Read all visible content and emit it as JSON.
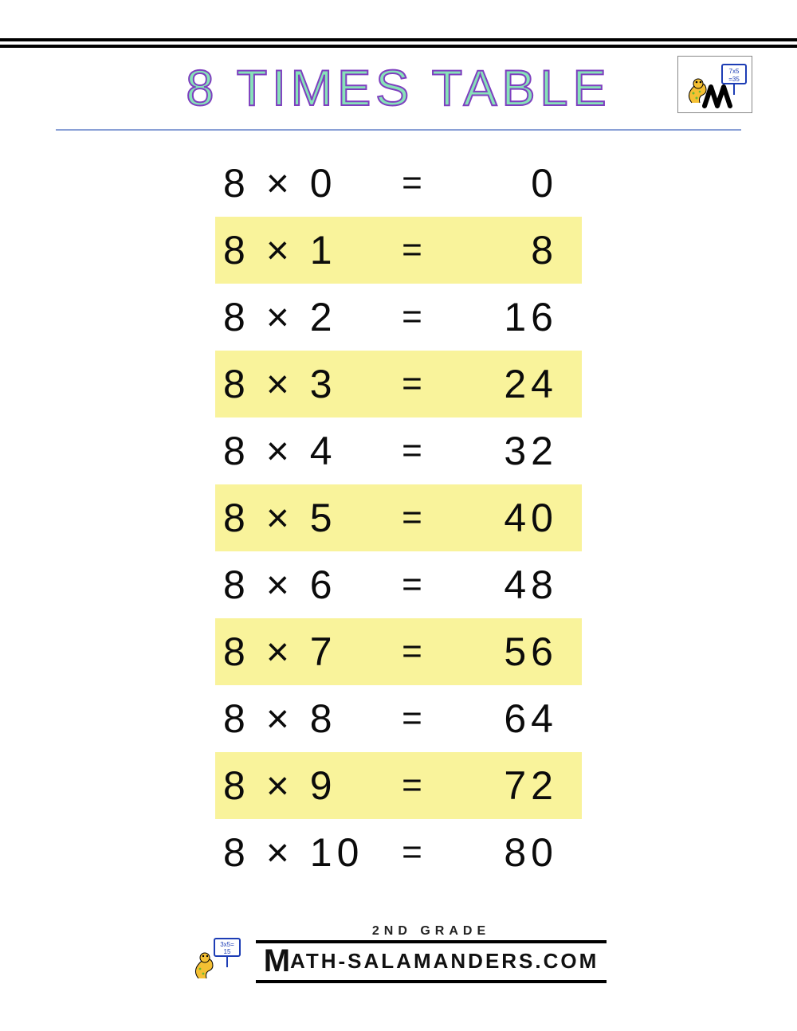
{
  "title": "8 TIMES TABLE",
  "chart_data": {
    "type": "table",
    "title": "8 Times Table",
    "rows": [
      {
        "a": "8",
        "op": "×",
        "b": "0",
        "result": "0",
        "highlight": false
      },
      {
        "a": "8",
        "op": "×",
        "b": "1",
        "result": "8",
        "highlight": true
      },
      {
        "a": "8",
        "op": "×",
        "b": "2",
        "result": "16",
        "highlight": false
      },
      {
        "a": "8",
        "op": "×",
        "b": "3",
        "result": "24",
        "highlight": true
      },
      {
        "a": "8",
        "op": "×",
        "b": "4",
        "result": "32",
        "highlight": false
      },
      {
        "a": "8",
        "op": "×",
        "b": "5",
        "result": "40",
        "highlight": true
      },
      {
        "a": "8",
        "op": "×",
        "b": "6",
        "result": "48",
        "highlight": false
      },
      {
        "a": "8",
        "op": "×",
        "b": "7",
        "result": "56",
        "highlight": true
      },
      {
        "a": "8",
        "op": "×",
        "b": "8",
        "result": "64",
        "highlight": false
      },
      {
        "a": "8",
        "op": "×",
        "b": "9",
        "result": "72",
        "highlight": true
      },
      {
        "a": "8",
        "op": "×",
        "b": "10",
        "result": "80",
        "highlight": false
      }
    ]
  },
  "corner_logo": {
    "board_text": "7x5\n=35"
  },
  "footer": {
    "grade": "2ND GRADE",
    "brand_lead": "M",
    "brand_rest": "ATH-SALAMANDERS.COM",
    "board_text": "3x5=\n 15"
  }
}
